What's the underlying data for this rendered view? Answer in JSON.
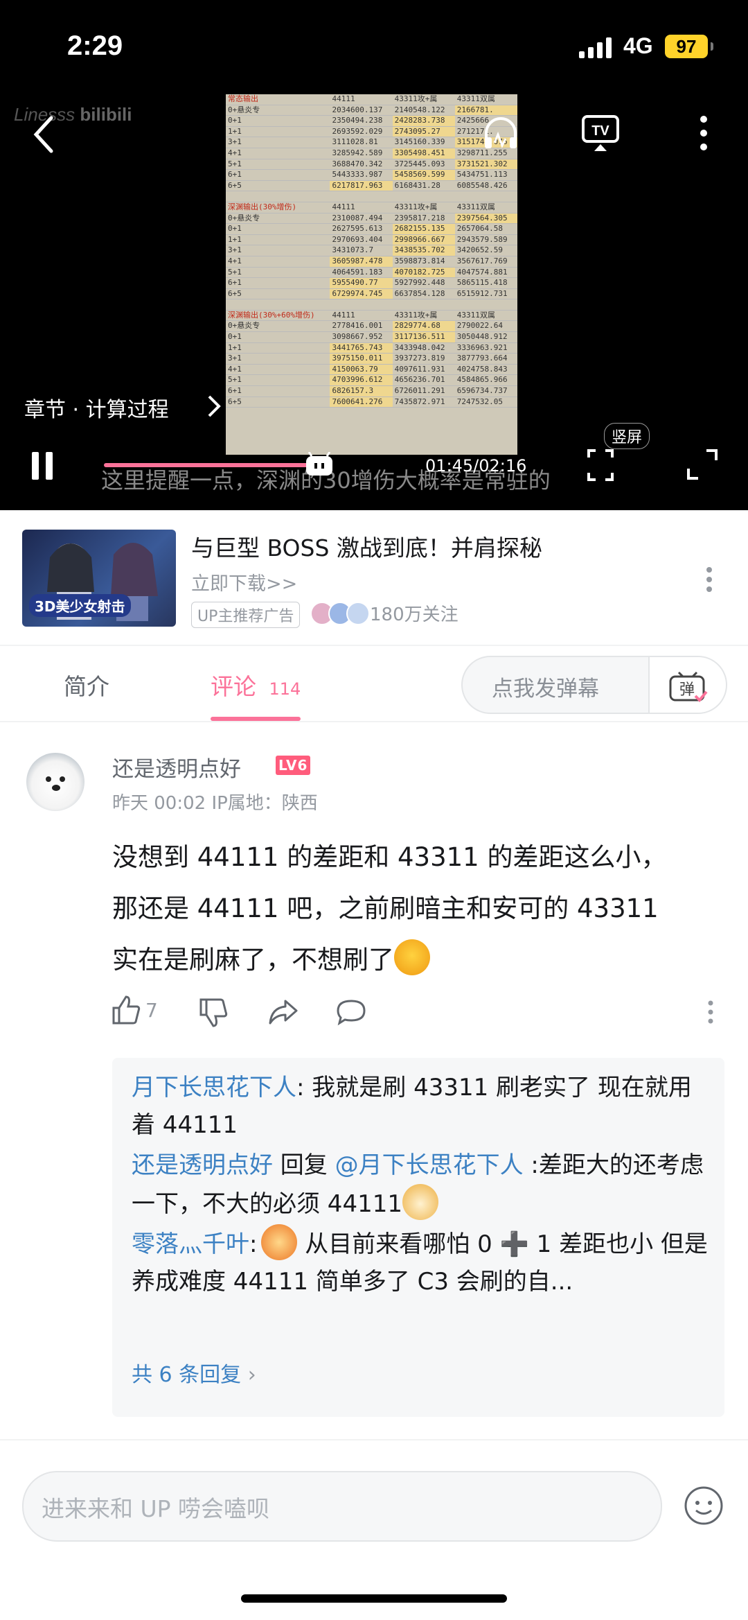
{
  "status_bar": {
    "time": "2:29",
    "network": "4G",
    "battery": "97"
  },
  "player": {
    "watermark": "Linesss",
    "chapter": "章节 · 计算过程",
    "subtitle": "这里提醒一点，深渊的30增伤大概率是常驻的",
    "time": "01:45/02:16",
    "vertical_label": "竖屏",
    "progress_fraction": 0.77,
    "table_sections": [
      {
        "header": [
          "常态输出",
          "44111",
          "43311攻+属",
          "43311双属"
        ],
        "rows": [
          [
            "0+悬炎专",
            "2034600.137",
            "2140548.122",
            "2166781."
          ],
          [
            "0+1",
            "2350494.238",
            "2428283.738",
            "2425666."
          ],
          [
            "1+1",
            "2693592.029",
            "2743095.27",
            "2712171."
          ],
          [
            "3+1",
            "3111028.81",
            "3145160.339",
            "3151746.076"
          ],
          [
            "4+1",
            "3285942.589",
            "3305498.451",
            "3298711.255"
          ],
          [
            "5+1",
            "3688470.342",
            "3725445.093",
            "3731521.302"
          ],
          [
            "6+1",
            "5443333.987",
            "5458569.599",
            "5434751.113"
          ],
          [
            "6+5",
            "6217817.963",
            "6168431.28",
            "6085548.426"
          ]
        ]
      },
      {
        "header": [
          "深渊输出(30%增伤)",
          "44111",
          "43311攻+属",
          "43311双属"
        ],
        "rows": [
          [
            "0+悬炎专",
            "2310087.494",
            "2395817.218",
            "2397564.305"
          ],
          [
            "0+1",
            "2627595.613",
            "2682155.135",
            "2657064.58"
          ],
          [
            "1+1",
            "2970693.404",
            "2998966.667",
            "2943579.589"
          ],
          [
            "3+1",
            "3431073.7",
            "3438535.702",
            "3420652.59"
          ],
          [
            "4+1",
            "3605987.478",
            "3598873.814",
            "3567617.769"
          ],
          [
            "5+1",
            "4064591.183",
            "4070182.725",
            "4047574.881"
          ],
          [
            "6+1",
            "5955490.77",
            "5927992.448",
            "5865115.418"
          ],
          [
            "6+5",
            "6729974.745",
            "6637854.128",
            "6515912.731"
          ]
        ]
      },
      {
        "header": [
          "深渊输出(30%+60%增伤)",
          "44111",
          "43311攻+属",
          "43311双属"
        ],
        "rows": [
          [
            "0+悬炎专",
            "2778416.001",
            "2829774.68",
            "2790022.64"
          ],
          [
            "0+1",
            "3098667.952",
            "3117136.511",
            "3050448.912"
          ],
          [
            "1+1",
            "3441765.743",
            "3433948.042",
            "3336963.921"
          ],
          [
            "3+1",
            "3975150.011",
            "3937273.819",
            "3877793.664"
          ],
          [
            "4+1",
            "4150063.79",
            "4097611.931",
            "4024758.843"
          ],
          [
            "5+1",
            "4703996.612",
            "4656236.701",
            "4584865.966"
          ],
          [
            "6+1",
            "6826157.3",
            "6726011.291",
            "6596734.737"
          ],
          [
            "6+5",
            "7600641.276",
            "7435872.971",
            "7247532.05"
          ]
        ]
      }
    ]
  },
  "ad": {
    "image_tag": "3D美少女射击",
    "title": "与巨型 BOSS 激战到底！并肩探秘",
    "subtitle": "立即下载>>",
    "badge": "UP主推荐广告",
    "fans": "180万关注"
  },
  "tabs": {
    "intro": "简介",
    "comments": "评论",
    "comment_count": "114",
    "danmaku_placeholder": "点我发弹幕",
    "danmaku_btn": "弹"
  },
  "comment": {
    "username": "还是透明点好",
    "level": "LV6",
    "meta": "昨天 00:02  IP属地：陕西",
    "lines": [
      "没想到 44111 的差距和 43311 的差距这么小，",
      "那还是 44111 吧，之前刷暗主和安可的 43311",
      "实在是刷麻了，不想刷了"
    ],
    "likes": "7"
  },
  "replies": {
    "r1_user": "月下长思花下人",
    "r1_text": ": 我就是刷 43311 刷老实了 现在就用着 44111",
    "r2_user": "还是透明点好",
    "r2_mid": " 回复 ",
    "r2_target": "@月下长思花下人",
    "r2_text": " :差距大的还考虑一下，不大的必须 44111",
    "r3_user": "零落灬千叶",
    "r3_text": " 从目前来看哪怕 0 ➕ 1 差距也小 但是养成难度 44111 简单多了 C3 会刷的自...",
    "more": "共 6 条回复"
  },
  "input": {
    "placeholder": "进来来和 UP 唠会嗑呗"
  }
}
